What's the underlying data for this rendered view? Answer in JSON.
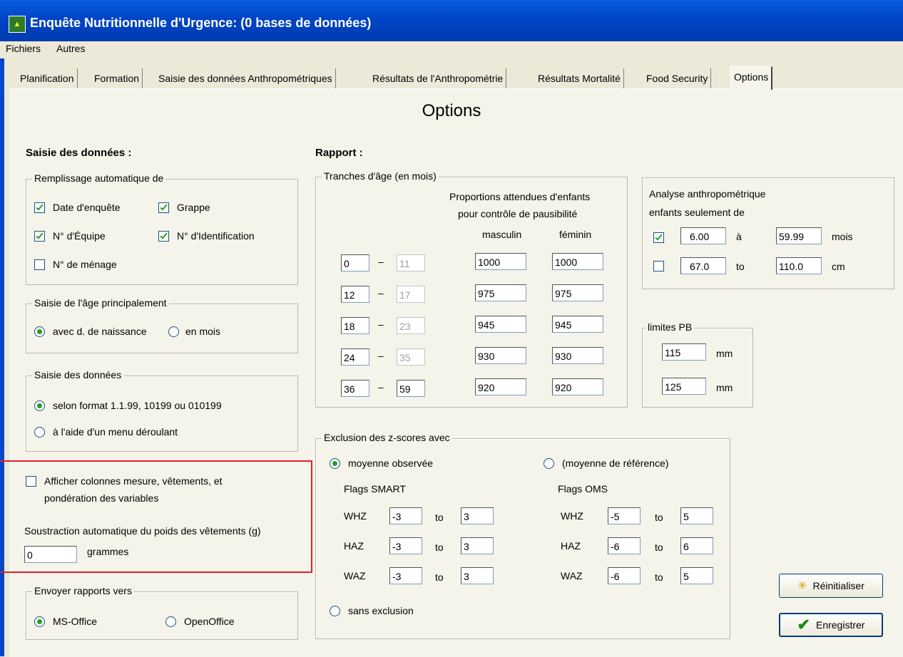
{
  "window": {
    "title": "Enquête Nutritionnelle d'Urgence:  (0 bases de données)"
  },
  "menu": [
    "Fichiers",
    "Autres"
  ],
  "tabs": [
    "Planification",
    "Formation",
    "Saisie des données Anthropométriques",
    "Résultats de l'Anthropométrie",
    "Résultats Mortalité",
    "Food Security",
    "Options"
  ],
  "active_tab": "Options",
  "page_title": "Options",
  "saisie": {
    "heading": "Saisie des données :",
    "auto": {
      "legend": "Remplissage automatique de",
      "items": [
        {
          "label": "Date d'enquête",
          "checked": true
        },
        {
          "label": "Grappe",
          "checked": true
        },
        {
          "label": "N° d'Équipe",
          "checked": true
        },
        {
          "label": "N° d'Identification",
          "checked": true
        },
        {
          "label": "N° de ménage",
          "checked": false
        }
      ]
    },
    "age": {
      "legend": "Saisie de l'âge principalement",
      "options": [
        "avec d. de naissance",
        "en mois"
      ],
      "selected": 0
    },
    "data": {
      "legend": "Saisie des données",
      "options": [
        "selon format 1.1.99, 10199 ou 010199",
        "à l'aide d'un menu déroulant"
      ],
      "selected": 0
    },
    "afficher": {
      "line1": "Afficher colonnes mesure, vêtements, et",
      "line2": "pondération des variables",
      "checked": false
    },
    "soustraction": {
      "label": "Soustraction automatique du poids des vêtements (g)",
      "value": "0",
      "unit": "grammes"
    },
    "envoyer": {
      "legend": "Envoyer rapports vers",
      "options": [
        "MS-Office",
        "OpenOffice"
      ],
      "selected": 0
    }
  },
  "rapport": {
    "heading": "Rapport :",
    "tranches": {
      "legend": "Tranches d'âge (en mois)",
      "prop_line1": "Proportions attendues d'enfants",
      "prop_line2": "pour contrôle de pausibilité",
      "col_m": "masculin",
      "col_f": "féminin",
      "rows": [
        {
          "from": "0",
          "to": "11",
          "m": "1000",
          "f": "1000"
        },
        {
          "from": "12",
          "to": "17",
          "m": "975",
          "f": "975"
        },
        {
          "from": "18",
          "to": "23",
          "m": "945",
          "f": "945"
        },
        {
          "from": "24",
          "to": "35",
          "m": "930",
          "f": "930"
        },
        {
          "from": "36",
          "to": "59",
          "m": "920",
          "f": "920"
        }
      ]
    },
    "analyse": {
      "line1": "Analyse anthropométrique",
      "line2": "enfants seulement de",
      "row1": {
        "checked": true,
        "from": "6.00",
        "sep": "à",
        "to": "59.99",
        "unit": "mois"
      },
      "row2": {
        "checked": false,
        "from": "67.0",
        "sep": "to",
        "to": "110.0",
        "unit": "cm"
      }
    },
    "pb": {
      "legend": "limites PB",
      "v1": "115",
      "v2": "125",
      "unit": "mm"
    },
    "exclusion": {
      "legend": "Exclusion des z-scores avec",
      "opt_obs": "moyenne observée",
      "opt_ref": "(moyenne de référence)",
      "opt_none": "sans exclusion",
      "selected": "obs",
      "smart": {
        "title": "Flags SMART",
        "rows": [
          {
            "name": "WHZ",
            "lo": "-3",
            "hi": "3"
          },
          {
            "name": "HAZ",
            "lo": "-3",
            "hi": "3"
          },
          {
            "name": "WAZ",
            "lo": "-3",
            "hi": "3"
          }
        ]
      },
      "oms": {
        "title": "Flags OMS",
        "rows": [
          {
            "name": "WHZ",
            "lo": "-5",
            "hi": "5"
          },
          {
            "name": "HAZ",
            "lo": "-6",
            "hi": "6"
          },
          {
            "name": "WAZ",
            "lo": "-6",
            "hi": "5"
          }
        ]
      },
      "to": "to"
    }
  },
  "buttons": {
    "reset": "Réinitialiser",
    "save": "Enregistrer"
  },
  "colors": {
    "titlebar": "#0046c8",
    "panel": "#f5f4ea",
    "highlight": "#e0202a"
  }
}
